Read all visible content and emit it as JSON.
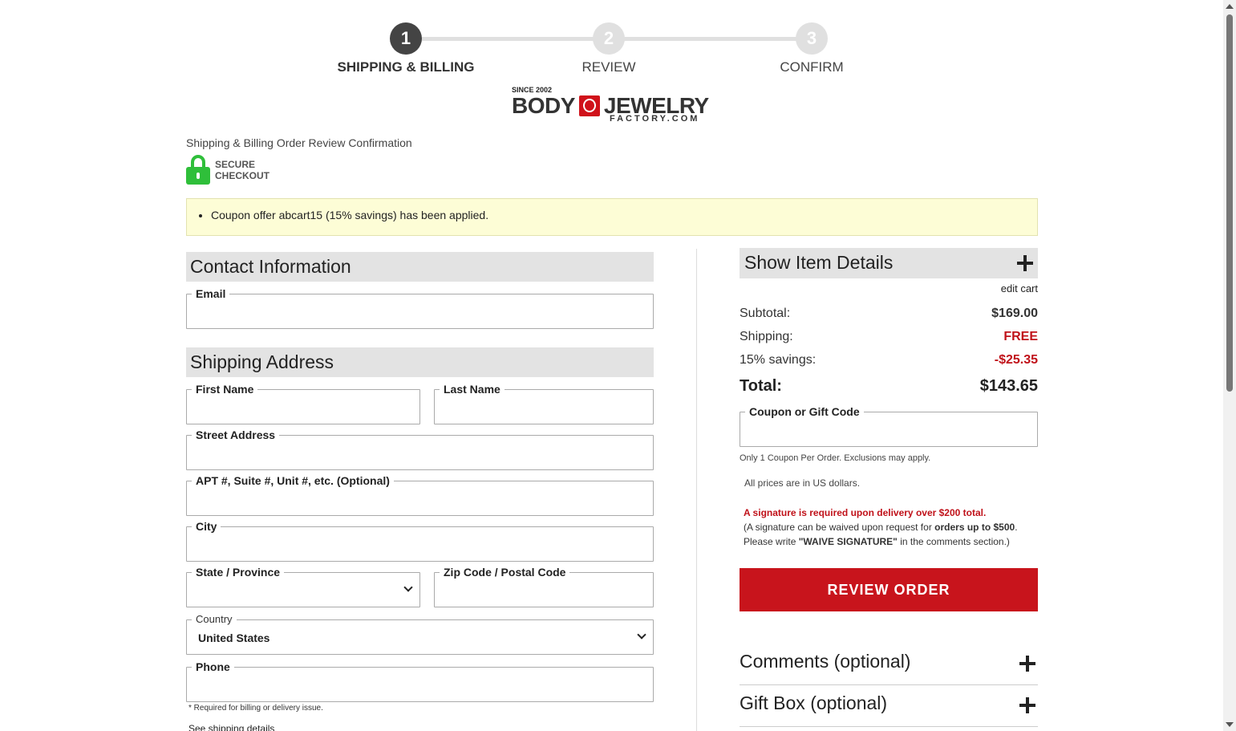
{
  "steps": [
    {
      "number": "1",
      "label": "SHIPPING & BILLING",
      "active": true
    },
    {
      "number": "2",
      "label": "REVIEW",
      "active": false
    },
    {
      "number": "3",
      "label": "CONFIRM",
      "active": false
    }
  ],
  "logo": {
    "since": "SINCE 2002",
    "left": "BODY",
    "right": "JEWELRY",
    "sub": "FACTORY.COM"
  },
  "breadcrumb_text": "Shipping & Billing Order Review Confirmation",
  "secure": {
    "line1": "SECURE",
    "line2": "CHECKOUT"
  },
  "notice": "Coupon offer abcart15 (15% savings) has been applied.",
  "contact": {
    "heading": "Contact Information",
    "email_label": "Email",
    "email_value": ""
  },
  "shipping": {
    "heading": "Shipping Address",
    "first_name_label": "First Name",
    "last_name_label": "Last Name",
    "street_label": "Street Address",
    "apt_label": "APT #, Suite #, Unit #, etc. (Optional)",
    "city_label": "City",
    "state_label": "State / Province",
    "state_value": "",
    "zip_label": "Zip Code / Postal Code",
    "country_label": "Country",
    "country_value": "United States",
    "phone_label": "Phone",
    "phone_note": "* Required for billing or delivery issue.",
    "shipping_details_link": "See shipping details"
  },
  "summary": {
    "item_details_label": "Show Item Details",
    "edit_cart": "edit cart",
    "subtotal_label": "Subtotal:",
    "subtotal_value": "$169.00",
    "shipping_label": "Shipping:",
    "shipping_value": "FREE",
    "savings_label": "15% savings:",
    "savings_value": "-$25.35",
    "total_label": "Total:",
    "total_value": "$143.65",
    "coupon_label": "Coupon or Gift Code",
    "coupon_note": "Only 1 Coupon Per Order. Exclusions may apply.",
    "prices_note": "All prices are in US dollars.",
    "signature_required": "A signature is required upon delivery over $200 total.",
    "signature_line2_a": "(A signature can be waived upon request for ",
    "signature_line2_b": "orders up to $500",
    "signature_line2_c": ".",
    "signature_line3_a": "Please write ",
    "signature_line3_b": "\"WAIVE SIGNATURE\"",
    "signature_line3_c": " in the comments section.)",
    "review_button": "REVIEW ORDER",
    "comments_label": "Comments (optional)",
    "giftbox_label": "Gift Box (optional)"
  },
  "colors": {
    "accent_red": "#c8141c",
    "secure_green": "#2fbf3a",
    "notice_bg": "#fdfdd6"
  }
}
